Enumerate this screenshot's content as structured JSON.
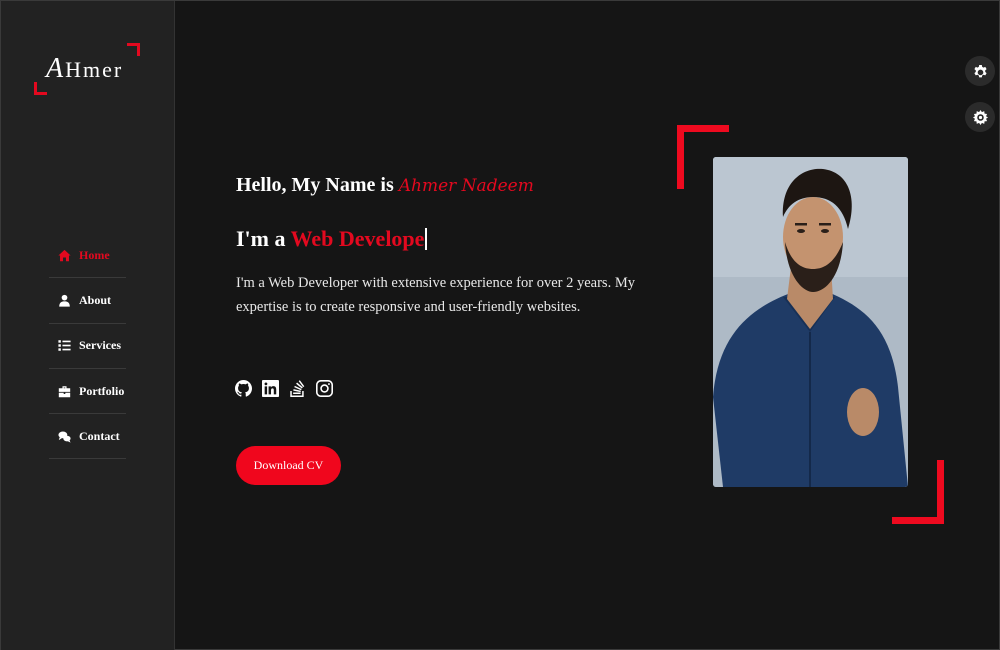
{
  "logo": {
    "first_letter": "A",
    "rest": "Hmer"
  },
  "nav": [
    {
      "label": "Home",
      "icon": "home-icon",
      "active": true
    },
    {
      "label": "About",
      "icon": "user-icon",
      "active": false
    },
    {
      "label": "Services",
      "icon": "list-icon",
      "active": false
    },
    {
      "label": "Portfolio",
      "icon": "briefcase-icon",
      "active": false
    },
    {
      "label": "Contact",
      "icon": "comments-icon",
      "active": false
    }
  ],
  "hero": {
    "greeting": "Hello, My Name is ",
    "name": "Ahmer Nadeem",
    "role_prefix": "I'm a ",
    "role_typed": "Web Develope",
    "bio": "I'm a Web Developer with extensive experience for over 2 years. My expertise is to create responsive and user-friendly websites.",
    "cv_button": "Download CV"
  },
  "socials": [
    "github-icon",
    "linkedin-icon",
    "stackoverflow-icon",
    "instagram-icon"
  ],
  "colors": {
    "accent": "#e3091f",
    "background": "#151515",
    "sidebar": "#222222"
  },
  "right_controls": [
    "settings-gear-icon",
    "theme-gear-icon"
  ]
}
